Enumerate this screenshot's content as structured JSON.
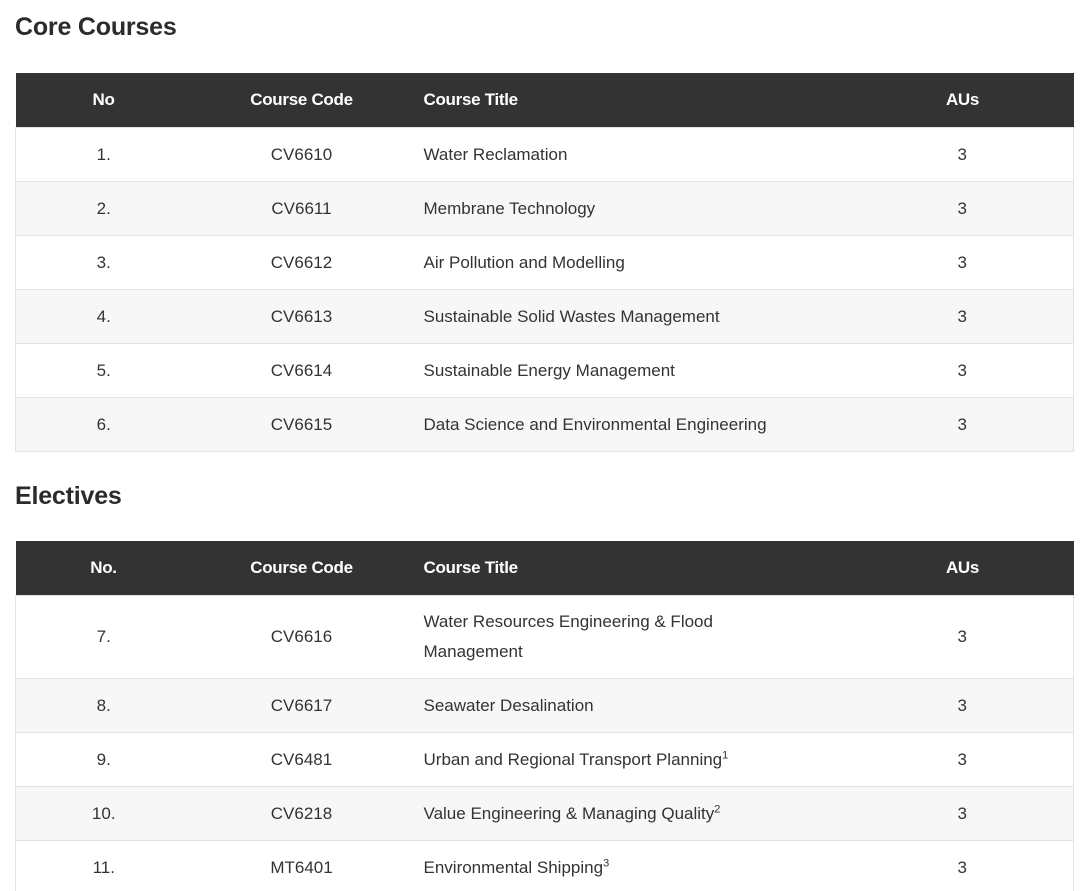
{
  "core": {
    "title": "Core Courses",
    "headers": {
      "no": "No",
      "code": "Course Code",
      "title": "Course Title",
      "aus": "AUs"
    },
    "rows": [
      {
        "no": "1.",
        "code": "CV6610",
        "title": "Water Reclamation",
        "aus": "3"
      },
      {
        "no": "2.",
        "code": "CV6611",
        "title": "Membrane Technology",
        "aus": "3"
      },
      {
        "no": "3.",
        "code": "CV6612",
        "title": "Air Pollution and Modelling",
        "aus": "3"
      },
      {
        "no": "4.",
        "code": "CV6613",
        "title": "Sustainable Solid Wastes Management",
        "aus": "3"
      },
      {
        "no": "5.",
        "code": "CV6614",
        "title": "Sustainable Energy Management",
        "aus": "3"
      },
      {
        "no": "6.",
        "code": "CV6615",
        "title": "Data Science and Environmental Engineering",
        "aus": "3"
      }
    ]
  },
  "electives": {
    "title": "Electives",
    "headers": {
      "no": "No.",
      "code": "Course Code",
      "title": "Course Title",
      "aus": "AUs"
    },
    "rows": [
      {
        "no": "7.",
        "code": "CV6616",
        "title_line1": "Water Resources Engineering & Flood",
        "title_line2": "Management",
        "aus": "3"
      },
      {
        "no": "8.",
        "code": "CV6617",
        "title": "Seawater Desalination",
        "aus": "3"
      },
      {
        "no": "9.",
        "code": "CV6481",
        "title": "Urban and Regional Transport Planning",
        "footnote": "1",
        "aus": "3"
      },
      {
        "no": "10.",
        "code": "CV6218",
        "title": "Value Engineering & Managing Quality",
        "footnote": "2",
        "aus": "3"
      },
      {
        "no": "11.",
        "code": "MT6401",
        "title": "Environmental Shipping",
        "footnote": "3",
        "aus": "3"
      }
    ]
  }
}
